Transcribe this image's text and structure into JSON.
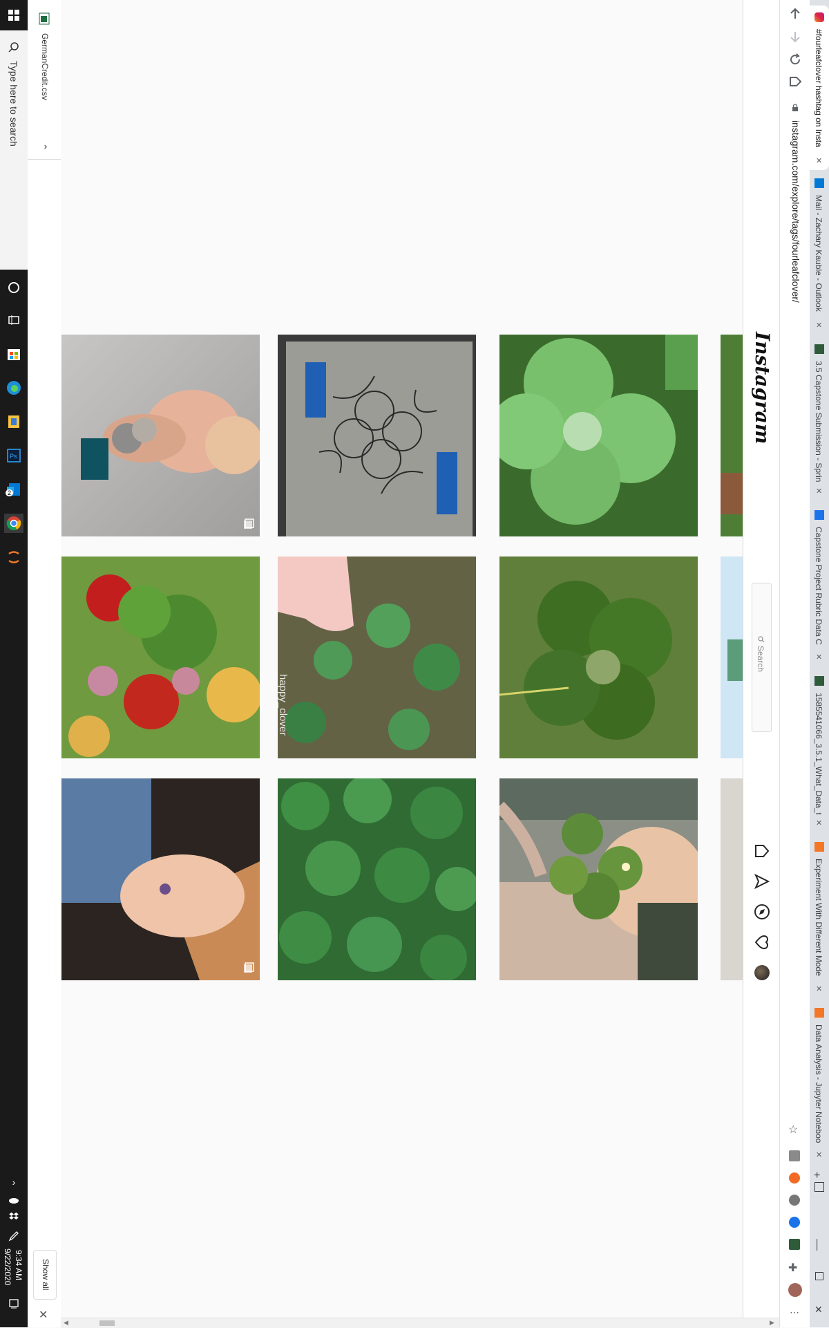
{
  "taskbar": {
    "search_placeholder": "Type here to search",
    "time": "9:34 AM",
    "date": "9/22/2020",
    "badge_count": "2"
  },
  "download_bar": {
    "file_name": "GermanCredit.csv",
    "show_all": "Show all"
  },
  "browser": {
    "url": "instagram.com/explore/tags/fourleafclover/",
    "tabs": [
      {
        "title": "#fourleafclover hashtag on Insta"
      },
      {
        "title": "Mail - Zachary Kauble - Outlook"
      },
      {
        "title": "3.5 Capstone Submission - Sprin"
      },
      {
        "title": "Capstone Project Rubric Data C"
      },
      {
        "title": "1585541066_3.5.1_What_Data_to"
      },
      {
        "title": "Experiment With Different Mode"
      },
      {
        "title": "Data Analysis - Jupyter Noteboo"
      }
    ]
  },
  "instagram": {
    "logo": "Instagram",
    "search_placeholder": "Search"
  },
  "posts": [
    {
      "alt": "child holding coins",
      "caption": ""
    },
    {
      "alt": "four leaf skull drawing",
      "caption": ""
    },
    {
      "alt": "four leaf clover closeup",
      "caption": ""
    },
    {
      "alt": "clover with red flowers",
      "caption": ""
    },
    {
      "alt": "finger on clover patch",
      "caption": "happy_clover"
    },
    {
      "alt": "four leaf clover on grass",
      "caption": ""
    },
    {
      "alt": "ankle clover tattoo",
      "caption": ""
    },
    {
      "alt": "clover patch",
      "caption": ""
    },
    {
      "alt": "clover against sunset",
      "caption": ""
    }
  ]
}
